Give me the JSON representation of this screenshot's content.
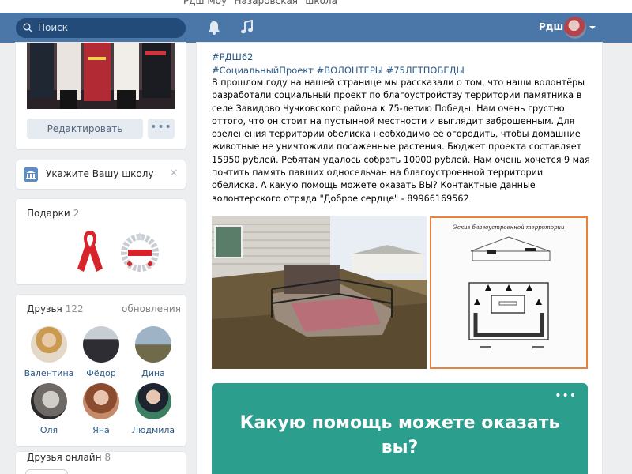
{
  "window": {
    "title": "Рдш Моу \"Назаровская\" школа"
  },
  "header": {
    "search_placeholder": "Поиск",
    "user_name": "Рдш"
  },
  "profile": {
    "edit_label": "Редактировать",
    "more_label": "•••"
  },
  "school": {
    "label": "Укажите Вашу школу",
    "close": "×"
  },
  "gifts": {
    "title": "Подарки",
    "count": "2"
  },
  "friends": {
    "title": "Друзья",
    "count": "122",
    "updates_link": "обновления",
    "items": [
      {
        "name": "Валентина"
      },
      {
        "name": "Фёдор"
      },
      {
        "name": "Дина"
      },
      {
        "name": "Оля"
      },
      {
        "name": "Яна"
      },
      {
        "name": "Людмила"
      }
    ]
  },
  "friends_online": {
    "title": "Друзья онлайн",
    "count": "8"
  },
  "post": {
    "tags_line1": "#РДШ62",
    "tags_line2": "#СоциальныйПроект #ВОЛОНТЕРЫ #75ЛЕТПОБЕДЫ",
    "text": "В прошлом году на нашей странице мы рассказали о том, что наши волонтёры разработали социальный проект по благоустройству территории памятника в селе Завидово Чучковского района к 75-летию Победы. Нам очень грустно оттого, что он стоит на пустынной местности и выглядит заброшенным. Для озеленения территории обелиска необходимо её огородить, чтобы домашние животные не уничтожили посаженные растения. Бюджет проекта составляет 15950 рублей. Ребятам удалось собрать 10000 рублей. Нам очень хочется 9 мая почтить память павших односельчан на благоустроенной территории обелиска. А какую помощь можете оказать ВЫ? Контактные данные волонтерского отряда \"Доброе сердце\" - 89966169562",
    "sketch_title": "Эскиз благоустроенной территории",
    "promo_text": "Какую помощь можете оказать вы?",
    "promo_more": "•••"
  },
  "colors": {
    "header": "#4a76a8",
    "link": "#2a5885",
    "promo": "#2c9e8d",
    "frame": "#e8823a"
  }
}
